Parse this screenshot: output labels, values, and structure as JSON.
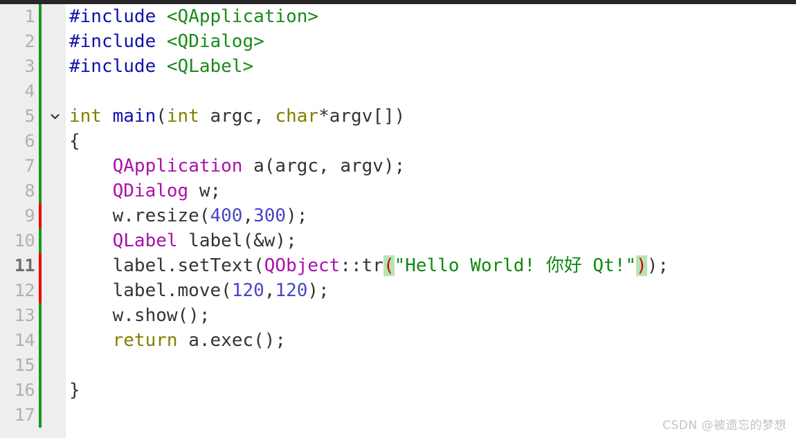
{
  "editor": {
    "app": "Qt Creator code editor",
    "language": "C++",
    "background_color": "#ffffff",
    "gutter_color": "#eeeeee",
    "top_bar_color": "#272727",
    "line_height_px": 36,
    "current_line": 11,
    "colors": {
      "preprocessor": "#1111aa",
      "include_path": "#1a8a1a",
      "keyword": "#808000",
      "function": "#1111aa",
      "type": "#aa11aa",
      "number": "#4646c8",
      "string": "#108810",
      "plain": "#333333",
      "paren_match_text": "#dd0000",
      "paren_match_bg": "#b4e6b4",
      "change_bar_added": "#15991a",
      "change_bar_modified": "#ee0000",
      "line_number": "#b0b0b0",
      "line_number_current": "#6f6f6f",
      "watermark": "#c3c3c3"
    }
  },
  "gutter": {
    "line_numbers": [
      "1",
      "2",
      "3",
      "4",
      "5",
      "6",
      "7",
      "8",
      "9",
      "10",
      "11",
      "12",
      "13",
      "14",
      "15",
      "16",
      "17"
    ],
    "change_bar_states": [
      "added",
      "added",
      "added",
      "added",
      "added",
      "added",
      "added",
      "added",
      "modified",
      "added",
      "modified",
      "modified",
      "added",
      "added",
      "added",
      "added",
      "added"
    ],
    "fold_marker_line": 5,
    "fold_marker_icon": "chevron-down-icon"
  },
  "code": {
    "lines": [
      {
        "number": 1,
        "tokens": [
          {
            "text": "#include",
            "type": "preproc"
          },
          {
            "text": " ",
            "type": "plain"
          },
          {
            "text": "<QApplication>",
            "type": "include"
          }
        ]
      },
      {
        "number": 2,
        "tokens": [
          {
            "text": "#include",
            "type": "preproc"
          },
          {
            "text": " ",
            "type": "plain"
          },
          {
            "text": "<QDialog>",
            "type": "include"
          }
        ]
      },
      {
        "number": 3,
        "tokens": [
          {
            "text": "#include",
            "type": "preproc"
          },
          {
            "text": " ",
            "type": "plain"
          },
          {
            "text": "<QLabel>",
            "type": "include"
          }
        ]
      },
      {
        "number": 4,
        "tokens": []
      },
      {
        "number": 5,
        "tokens": [
          {
            "text": "int",
            "type": "keyword"
          },
          {
            "text": " ",
            "type": "plain"
          },
          {
            "text": "main",
            "type": "function"
          },
          {
            "text": "(",
            "type": "plain"
          },
          {
            "text": "int",
            "type": "keyword"
          },
          {
            "text": " argc, ",
            "type": "plain"
          },
          {
            "text": "char",
            "type": "keyword"
          },
          {
            "text": "*argv[])",
            "type": "plain"
          }
        ]
      },
      {
        "number": 6,
        "tokens": [
          {
            "text": "{",
            "type": "plain"
          }
        ]
      },
      {
        "number": 7,
        "tokens": [
          {
            "text": "    ",
            "type": "plain"
          },
          {
            "text": "QApplication",
            "type": "type"
          },
          {
            "text": " a(argc, argv);",
            "type": "plain"
          }
        ]
      },
      {
        "number": 8,
        "tokens": [
          {
            "text": "    ",
            "type": "plain"
          },
          {
            "text": "QDialog",
            "type": "type"
          },
          {
            "text": " w;",
            "type": "plain"
          }
        ]
      },
      {
        "number": 9,
        "tokens": [
          {
            "text": "    w.resize(",
            "type": "plain"
          },
          {
            "text": "400",
            "type": "number"
          },
          {
            "text": ",",
            "type": "plain"
          },
          {
            "text": "300",
            "type": "number"
          },
          {
            "text": ");",
            "type": "plain"
          }
        ]
      },
      {
        "number": 10,
        "tokens": [
          {
            "text": "    ",
            "type": "plain"
          },
          {
            "text": "QLabel",
            "type": "type"
          },
          {
            "text": " label(&w);",
            "type": "plain"
          }
        ]
      },
      {
        "number": 11,
        "tokens": [
          {
            "text": "    label.setText(",
            "type": "plain"
          },
          {
            "text": "QObject",
            "type": "type"
          },
          {
            "text": "::tr",
            "type": "plain"
          },
          {
            "text": "(",
            "type": "paren-match"
          },
          {
            "text": "\"Hello World! 你好 Qt!\"",
            "type": "string"
          },
          {
            "text": ")",
            "type": "paren-match"
          },
          {
            "text": ");",
            "type": "plain"
          }
        ]
      },
      {
        "number": 12,
        "tokens": [
          {
            "text": "    label.move(",
            "type": "plain"
          },
          {
            "text": "120",
            "type": "number"
          },
          {
            "text": ",",
            "type": "plain"
          },
          {
            "text": "120",
            "type": "number"
          },
          {
            "text": ");",
            "type": "plain"
          }
        ]
      },
      {
        "number": 13,
        "tokens": [
          {
            "text": "    w.show();",
            "type": "plain"
          }
        ]
      },
      {
        "number": 14,
        "tokens": [
          {
            "text": "    ",
            "type": "plain"
          },
          {
            "text": "return",
            "type": "keyword"
          },
          {
            "text": " a.exec();",
            "type": "plain"
          }
        ]
      },
      {
        "number": 15,
        "tokens": []
      },
      {
        "number": 16,
        "tokens": [
          {
            "text": "}",
            "type": "plain"
          }
        ]
      },
      {
        "number": 17,
        "tokens": []
      }
    ]
  },
  "watermark": {
    "text": "CSDN @被遗忘的梦想"
  }
}
